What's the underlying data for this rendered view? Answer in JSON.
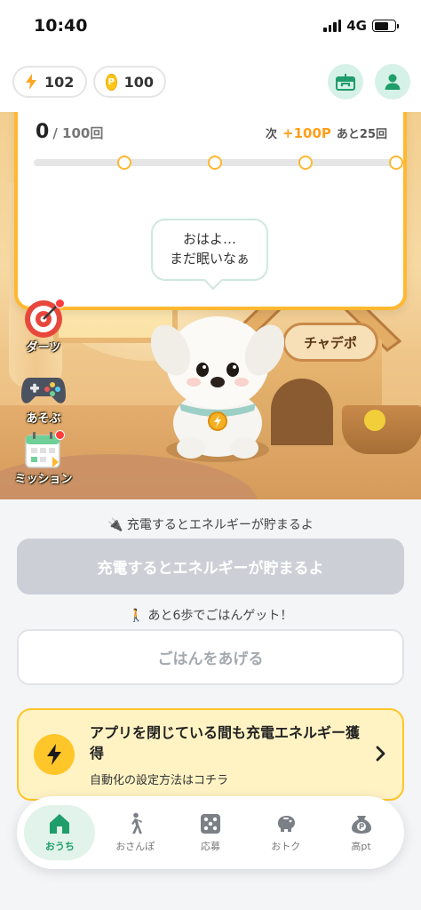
{
  "status_bar": {
    "time": "10:40",
    "network": "4G"
  },
  "header": {
    "energy": "102",
    "points": "100",
    "coin_symbol": "P"
  },
  "progress": {
    "current": "0",
    "total": "/ 100回",
    "next_label": "次",
    "next_reward": "+100P",
    "remaining": "あと25回",
    "milestones": 4
  },
  "speech_bubble": {
    "line1": "おはよ…",
    "line2": "まだ眠いなぁ"
  },
  "nameplate": "チャデポ",
  "side_menu": [
    {
      "label": "ダーツ",
      "icon": "dartboard-icon"
    },
    {
      "label": "あそぶ",
      "icon": "gamepad-icon"
    },
    {
      "label": "ミッション",
      "icon": "calendar-icon"
    }
  ],
  "charge_hint": "🔌 充電するとエネルギーが貯まるよ",
  "charge_button": "充電するとエネルギーが貯まるよ",
  "walk_hint": "🚶 あと6歩でごはんゲット！",
  "feed_button": "ごはんをあげる",
  "promo": {
    "title": "アプリを閉じている間も充電エネルギー獲得",
    "subtitle": "自動化の設定方法はコチラ"
  },
  "nav": [
    {
      "label": "おうち",
      "icon": "home-icon",
      "active": true
    },
    {
      "label": "おさんぽ",
      "icon": "walk-icon",
      "active": false
    },
    {
      "label": "応募",
      "icon": "dice-icon",
      "active": false
    },
    {
      "label": "おトク",
      "icon": "piggybank-icon",
      "active": false
    },
    {
      "label": "高pt",
      "icon": "points-bag-icon",
      "active": false
    }
  ],
  "colors": {
    "accent_green": "#1f9d6b",
    "accent_orange": "#ffb830",
    "reward_orange": "#ff9f1a",
    "promo_yellow": "#ffc629"
  }
}
